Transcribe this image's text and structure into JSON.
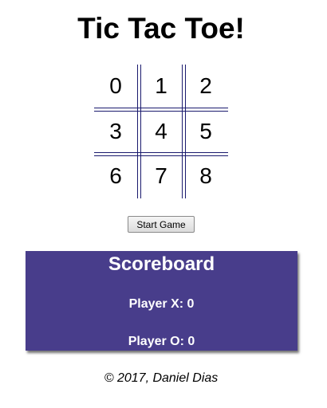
{
  "header": {
    "title": "Tic Tac Toe!"
  },
  "board": {
    "cells": [
      "0",
      "1",
      "2",
      "3",
      "4",
      "5",
      "6",
      "7",
      "8"
    ],
    "line_color": "#1a1a6e"
  },
  "controls": {
    "start_label": "Start Game"
  },
  "scoreboard": {
    "title": "Scoreboard",
    "player_x": "Player X: 0",
    "player_o": "Player O: 0",
    "background_color": "#483d8b"
  },
  "footer": {
    "text": "© 2017, Daniel Dias"
  }
}
